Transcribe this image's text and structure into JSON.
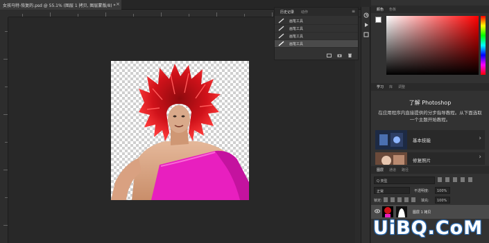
{
  "document": {
    "tab_title": "女孩马特-恢复的.psd @ 55.1% (图层 1 拷贝, 图层蒙版/8) *",
    "close_glyph": "×"
  },
  "history_panel": {
    "tabs": [
      "历史记录",
      "动作"
    ],
    "menu_glyph": "≡",
    "items": [
      "画笔工具",
      "画笔工具",
      "画笔工具",
      "画笔工具"
    ],
    "active_index": 3,
    "footer_icons": [
      "snapshot-icon",
      "camera-icon",
      "trash-icon"
    ]
  },
  "tool_strip": {
    "icons": [
      "history-icon",
      "actions-icon",
      "properties-icon"
    ]
  },
  "color_panel": {
    "tabs": [
      "颜色",
      "色板"
    ],
    "foreground": "#ffffff",
    "background": "#000000",
    "hue": "#ff0000"
  },
  "learn_panel": {
    "tabs": [
      "学习",
      "库",
      "调整"
    ],
    "title": "了解 Photoshop",
    "description": "在应用程序内直接提供的分步指导教程。从下面选取一个主题开始教程。",
    "tutorials": [
      {
        "label": "基本技能",
        "arrow": "›"
      },
      {
        "label": "修复照片",
        "arrow": "›"
      }
    ]
  },
  "layers_panel": {
    "tabs": [
      "图层",
      "通道",
      "路径"
    ],
    "filter_label": "Q 类型",
    "blend_mode": "正常",
    "opacity_label": "不透明度:",
    "opacity_value": "100%",
    "lock_label": "锁定:",
    "fill_label": "填充:",
    "fill_value": "100%",
    "layer_name": "图层 1 拷贝"
  },
  "watermark": {
    "text": "UiBQ.CoM"
  },
  "colors": {
    "ui_dark": "#282828",
    "panel": "#323232",
    "hair_red": "#d0121a",
    "top_magenta": "#e81fbf",
    "watermark_blue": "#2b6db5"
  }
}
